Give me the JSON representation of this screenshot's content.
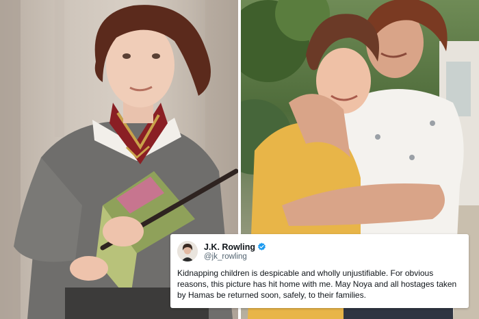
{
  "images": {
    "left_photo": {
      "icon": "photo-girl-costume"
    },
    "right_photo": {
      "icon": "photo-girl-and-grandmother"
    }
  },
  "tweet": {
    "display_name": "J.K. Rowling",
    "handle": "@jk_rowling",
    "verified_icon": "verified-badge-icon",
    "avatar_icon": "profile-avatar",
    "text": "Kidnapping children is despicable and wholly unjustifiable. For obvious reasons, this picture has hit home with me. May Noya and all hostages taken by Hamas be returned soon, safely, to their families."
  },
  "colors": {
    "verified_blue": "#1d9bf0",
    "name_text": "#0f1419",
    "handle_text": "#536471"
  }
}
